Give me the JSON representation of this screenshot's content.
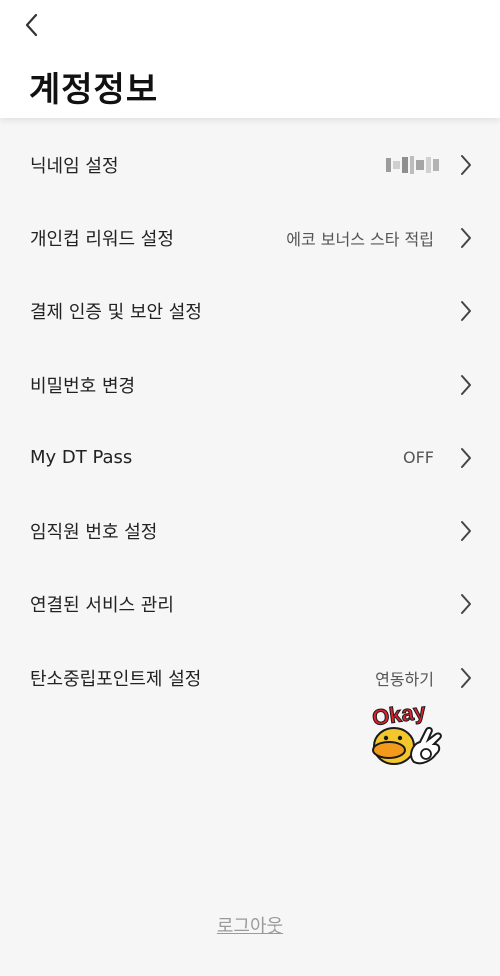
{
  "header": {
    "title": "계정정보",
    "back_icon": "chevron-left-icon"
  },
  "menu": [
    {
      "label": "닉네임 설정",
      "value": "",
      "value_blurred": true
    },
    {
      "label": "개인컵 리워드 설정",
      "value": "에코 보너스 스타 적립"
    },
    {
      "label": "결제 인증 및 보안 설정",
      "value": ""
    },
    {
      "label": "비밀번호 변경",
      "value": ""
    },
    {
      "label": "My DT Pass",
      "value": "OFF"
    },
    {
      "label": "임직원 번호 설정",
      "value": ""
    },
    {
      "label": "연결된 서비스 관리",
      "value": ""
    },
    {
      "label": "탄소중립포인트제 설정",
      "value": "연동하기"
    }
  ],
  "sticker": {
    "text": "Okay"
  },
  "footer": {
    "logout_label": "로그아웃"
  },
  "colors": {
    "background": "#f6f6f6",
    "header_bg": "#ffffff",
    "text": "#222222",
    "muted": "#9a9a9a"
  }
}
